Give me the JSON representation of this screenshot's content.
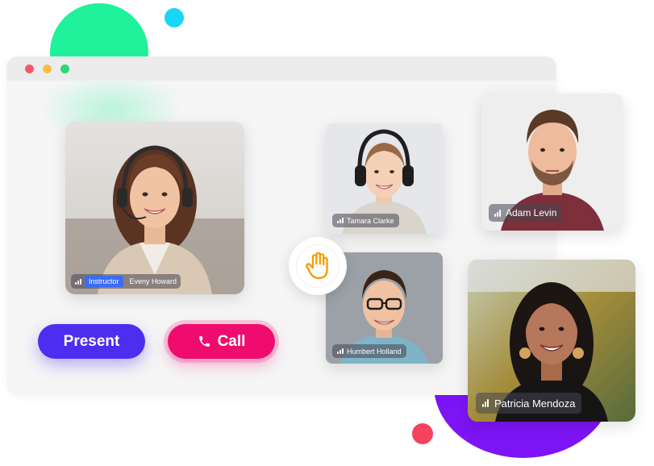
{
  "participants": {
    "main": {
      "name": "Eveny Howard",
      "role_badge": "Instructor"
    },
    "top_middle": {
      "name": "Tamara Clarke"
    },
    "bottom_middle": {
      "name": "Humbert Holland"
    },
    "top_right": {
      "name": "Adam Levin"
    },
    "bottom_right": {
      "name": "Patricia Mendoza"
    }
  },
  "controls": {
    "present_label": "Present",
    "call_label": "Call"
  },
  "icons": {
    "raise_hand": "raised-hand-icon",
    "call": "phone-icon",
    "signal": "signal-bars-icon"
  },
  "colors": {
    "present_button": "#4d2df0",
    "call_button": "#ef0c6e",
    "instructor_badge": "#3b6cf6",
    "raise_hand": "#f59e0b",
    "window_close": "#f65665",
    "window_minimize": "#fdbd41",
    "window_maximize": "#2ad96f"
  }
}
